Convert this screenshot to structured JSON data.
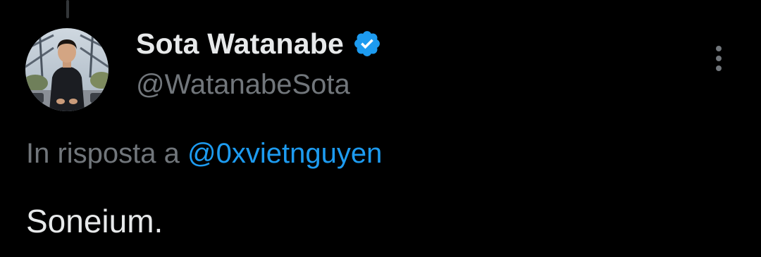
{
  "thread": {
    "has_connector_line": true
  },
  "author": {
    "display_name": "Sota Watanabe",
    "handle": "@WatanabeSota",
    "verified": true,
    "verified_icon": "verified-badge-icon",
    "avatar_icon": "profile-photo"
  },
  "reply_context": {
    "prefix": "In risposta a ",
    "mention": "@0xvietnguyen"
  },
  "tweet": {
    "text": "Soneium."
  },
  "menu": {
    "icon": "more-vertical-icon"
  },
  "colors": {
    "background": "#000000",
    "primary_text": "#e7e9ea",
    "secondary_text": "#71767b",
    "accent": "#1d9bf0",
    "thread_line": "#333639"
  }
}
